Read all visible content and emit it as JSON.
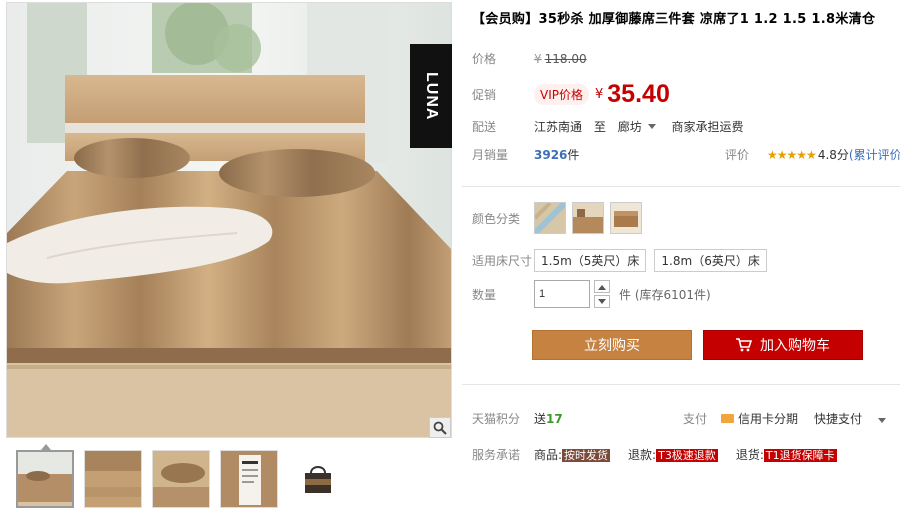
{
  "title": "【会员购】35秒杀 加厚御藤席三件套 凉席了1 1.2 1.5 1.8米清仓",
  "brand_tag": "LUNA",
  "price_block": {
    "orig_label": "价格",
    "orig_currency": "¥",
    "orig_price": "118.00",
    "promo_label": "促销",
    "vip_badge": "VIP价格",
    "promo_currency": "¥",
    "promo_price": "35.40"
  },
  "shipping": {
    "label": "配送",
    "from": "江苏南通",
    "to_word": "至",
    "dest": "廊坊",
    "fee_text": "商家承担运费"
  },
  "sales": {
    "label": "月销量",
    "count": "3926",
    "unit": "件",
    "rating_label": "评价",
    "stars": "★★★★★",
    "score": "4.8分",
    "review_link": "(累计评价"
  },
  "color": {
    "label": "颜色分类",
    "swatch_icons": [
      "sample-swatch",
      "room-swatch",
      "sofa-swatch"
    ]
  },
  "size": {
    "label": "适用床尺寸",
    "options": [
      "1.5m（5英尺）床",
      "1.8m（6英尺）床"
    ]
  },
  "quantity": {
    "label": "数量",
    "value": "1",
    "stock_text": "件 (库存6101件)"
  },
  "buttons": {
    "buy_now": "立刻购买",
    "add_cart": "加入购物车"
  },
  "points": {
    "label": "天猫积分",
    "prefix": "送",
    "value": "17"
  },
  "payment": {
    "label": "支付",
    "credit": "信用卡分期",
    "quick": "快捷支付"
  },
  "service": {
    "label": "服务承诺",
    "items": [
      {
        "prefix": "商品:",
        "tag": "按时发货"
      },
      {
        "prefix": "退款:",
        "tag": "T3极速退款"
      },
      {
        "prefix": "退货:",
        "tag": "T1退货保障卡"
      }
    ]
  },
  "colors": {
    "accent_red": "#c40000",
    "buy_brown": "#c58241",
    "link_blue": "#3d6fb6"
  }
}
